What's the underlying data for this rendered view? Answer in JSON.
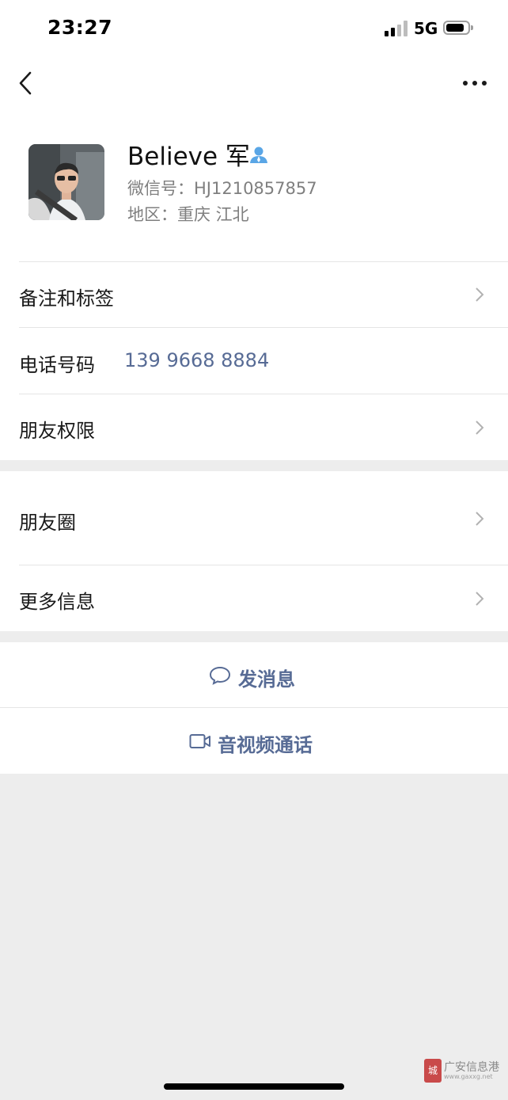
{
  "status_bar": {
    "time": "23:27",
    "network": "5G"
  },
  "profile": {
    "name": "Believe 军",
    "wechat_id_label": "微信号：",
    "wechat_id": "HJ1210857857",
    "region_label": "地区：",
    "region": "重庆 江北"
  },
  "rows": {
    "remark": "备注和标签",
    "phone_label": "电话号码",
    "phone_value": "139 9668 8884",
    "permission": "朋友权限",
    "moments": "朋友圈",
    "more_info": "更多信息"
  },
  "actions": {
    "message": "发消息",
    "call": "音视频通话"
  },
  "watermark": {
    "text": "广安信息港",
    "sub": "www.gaxxg.net",
    "seal": "城市"
  },
  "colors": {
    "link": "#576b95",
    "background": "#ededed",
    "badge": "#5aa6e6"
  }
}
